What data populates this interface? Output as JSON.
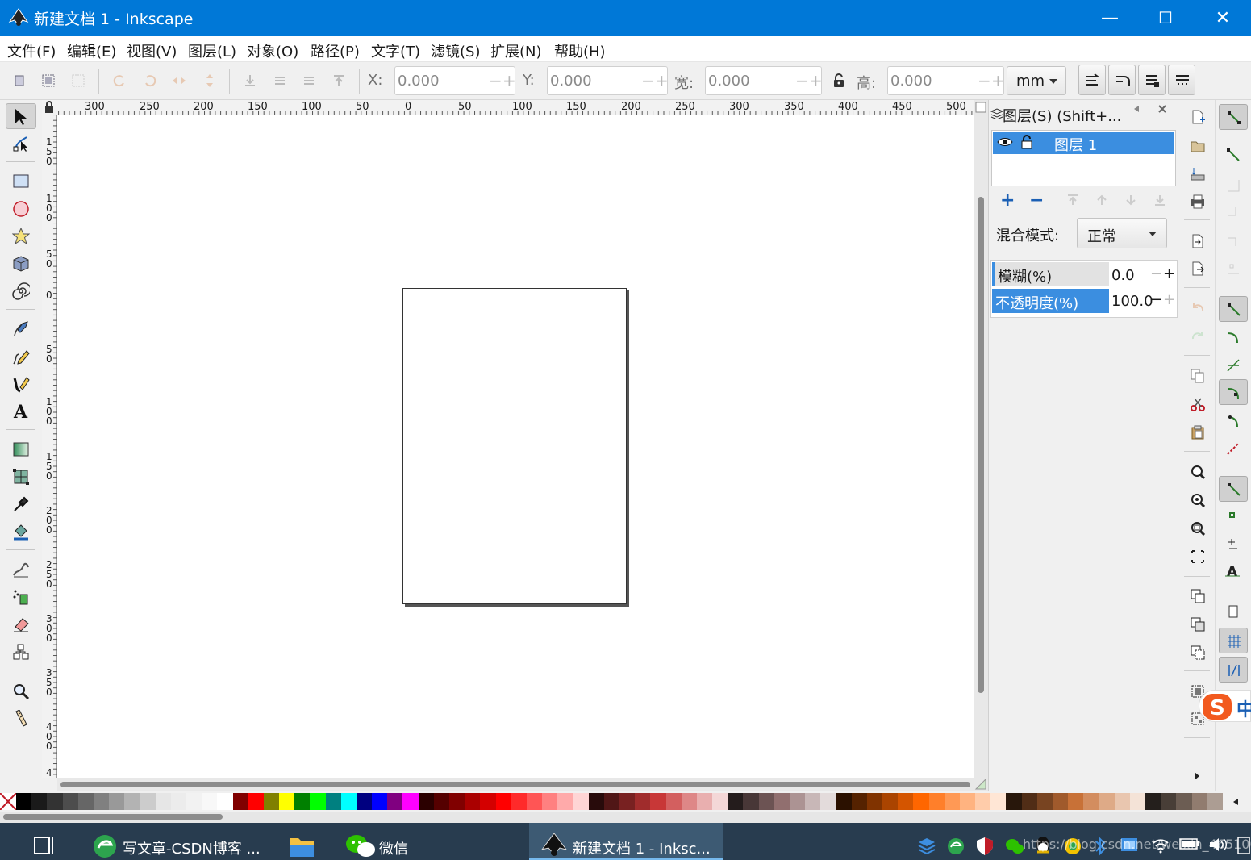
{
  "window": {
    "title": "新建文档 1 - Inkscape",
    "minimize_glyph": "—",
    "maximize_glyph": "☐",
    "close_glyph": "✕"
  },
  "menu": [
    "文件(F)",
    "编辑(E)",
    "视图(V)",
    "图层(L)",
    "对象(O)",
    "路径(P)",
    "文字(T)",
    "滤镜(S)",
    "扩展(N)",
    "帮助(H)"
  ],
  "toolbar": {
    "x_label": "X:",
    "x_value": "0.000",
    "y_label": "Y:",
    "y_value": "0.000",
    "w_label": "宽:",
    "w_value": "0.000",
    "h_label": "高:",
    "h_value": "0.000",
    "unit": "mm",
    "minus": "−",
    "plus": "+"
  },
  "ruler": {
    "h_labels": [
      "300",
      "250",
      "200",
      "150",
      "100",
      "50",
      "0",
      "50",
      "100",
      "150",
      "200",
      "250",
      "300",
      "350",
      "400",
      "450",
      "500"
    ],
    "v_labels": [
      "1\n5\n0",
      "1\n0\n0",
      "5\n0",
      "0",
      "5\n0",
      "1\n0\n0",
      "1\n5\n0",
      "2\n0\n0",
      "2\n5\n0",
      "3\n0\n0",
      "3\n5\n0",
      "4\n0\n0",
      "4"
    ]
  },
  "layers_panel": {
    "title": "图层(S) (Shift+...",
    "layer_name": "图层 1",
    "add_glyph": "+",
    "remove_glyph": "−",
    "blend_label": "混合模式:",
    "blend_value": "正常",
    "blur_label": "模糊(%)",
    "blur_value": "0.0",
    "opacity_label": "不透明度(%)",
    "opacity_value": "100.0"
  },
  "ime": {
    "label": "中"
  },
  "taskbar": {
    "items": [
      {
        "label": "写文章-CSDN博客 ..."
      },
      {
        "label": ""
      },
      {
        "label": "微信"
      },
      {
        "label": "新建文档 1 - Inksc..."
      }
    ],
    "watermark": "https://blog.csdn.net/weixin_4651005"
  },
  "palette_colors": [
    "#000000",
    "#1a1a1a",
    "#333333",
    "#4d4d4d",
    "#666666",
    "#808080",
    "#999999",
    "#b3b3b3",
    "#cccccc",
    "#e6e6e6",
    "#ececec",
    "#f2f2f2",
    "#f8f8f8",
    "#ffffff",
    "#800000",
    "#ff0000",
    "#808000",
    "#ffff00",
    "#008000",
    "#00ff00",
    "#008080",
    "#00ffff",
    "#000080",
    "#0000ff",
    "#800080",
    "#ff00ff",
    "#2b0000",
    "#550000",
    "#800000",
    "#aa0000",
    "#d40000",
    "#ff0000",
    "#ff2a2a",
    "#ff5555",
    "#ff8080",
    "#ffaaaa",
    "#ffd5d5",
    "#280b0b",
    "#501616",
    "#782121",
    "#a02c2c",
    "#c83737",
    "#d35f5f",
    "#de8787",
    "#e9afaf",
    "#f4d7d7",
    "#241c1c",
    "#483737",
    "#6c5353",
    "#916f6f",
    "#ac9393",
    "#c8b7b7",
    "#e3dbdb",
    "#2b1100",
    "#552200",
    "#803300",
    "#aa4400",
    "#d45500",
    "#ff6600",
    "#ff7f2a",
    "#ff9955",
    "#ffb380",
    "#ffccaa",
    "#ffe6d5",
    "#28170b",
    "#502d16",
    "#784421",
    "#a05a2c",
    "#c87137",
    "#d38d5f",
    "#deaa87",
    "#e9c6af",
    "#f4e3d7",
    "#241f1c",
    "#483e37",
    "#6c5d53",
    "#917c6f",
    "#ac9d93"
  ],
  "accent": "#0078d7",
  "selection": "#3b8ee0"
}
